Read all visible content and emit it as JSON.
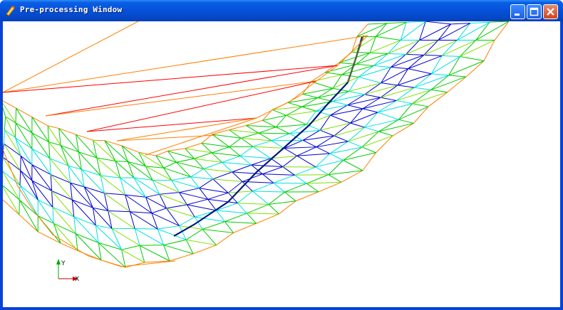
{
  "window": {
    "title": "Pre-processing Window",
    "icon": "pencil-icon",
    "controls": [
      "minimize",
      "maximize",
      "close"
    ]
  },
  "viewport": {
    "axes": {
      "y_label": "Y",
      "x_label": "X",
      "y_color": "#00aa00",
      "x_color": "#cc0000"
    },
    "mesh_colors": [
      "#ff7f00",
      "#ff0000",
      "#00cc00",
      "#80e000",
      "#00e0e0",
      "#0000cc",
      "#001a80"
    ]
  }
}
